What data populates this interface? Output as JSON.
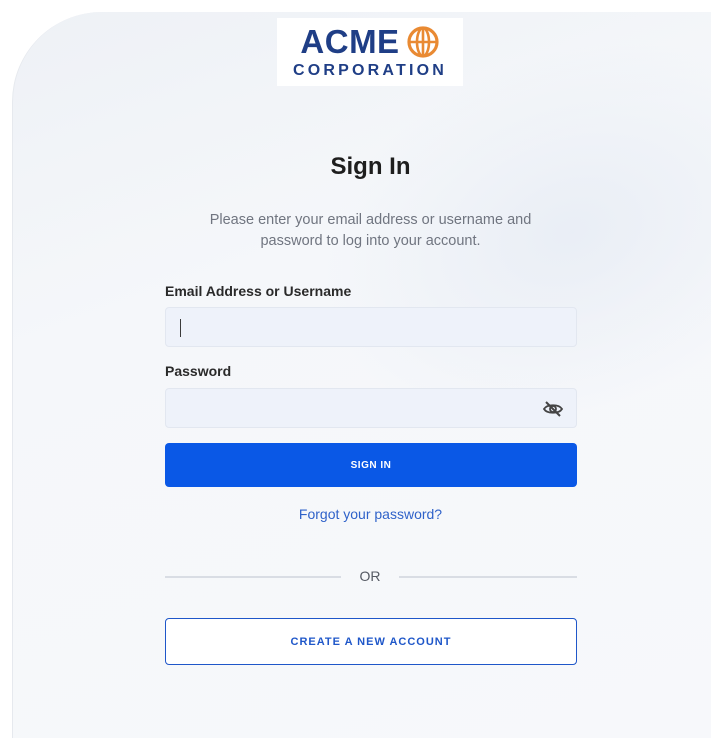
{
  "brand": {
    "name_top": "ACME",
    "name_bottom": "CORPORATION",
    "color": "#1f3e86",
    "globe_color": "#e98a33"
  },
  "login": {
    "title": "Sign In",
    "subtitle": "Please enter your email address or username and password to log into your account.",
    "email_label": "Email Address or Username",
    "email_value": "",
    "password_label": "Password",
    "password_value": "",
    "sign_in_label": "SIGN IN",
    "forgot_link": "Forgot your password?",
    "divider_text": "OR",
    "create_account_label": "CREATE A NEW ACCOUNT"
  },
  "icons": {
    "password_toggle": "eye-slash-icon",
    "logo_globe": "globe-icon"
  },
  "colors": {
    "primary": "#0a58e6",
    "link": "#2f62c9",
    "input_bg": "#eef2fa"
  }
}
